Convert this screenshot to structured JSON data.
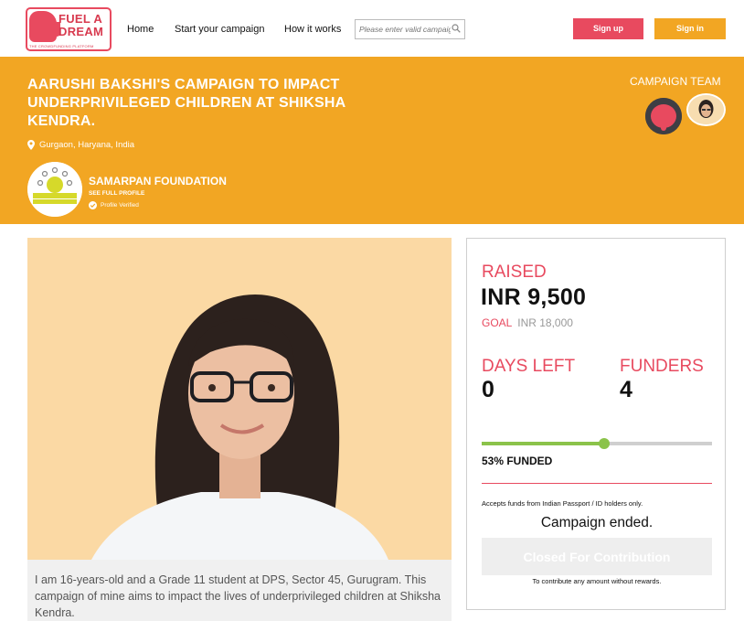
{
  "brand": {
    "logo_text": "FUEL A DREAM",
    "tagline": "THE CROWDFUNDING PLATFORM",
    "primary_color": "#e84a5f",
    "accent_color": "#f2a623"
  },
  "nav": {
    "home": "Home",
    "start_campaign": "Start your campaign",
    "how_it_works": "How it works",
    "search_placeholder": "Please enter valid campaign"
  },
  "auth": {
    "signup": "Sign up",
    "signin": "Sign in"
  },
  "campaign": {
    "title": "AARUSHI BAKSHI'S CAMPAIGN TO IMPACT UNDERPRIVILEGED CHILDREN AT SHIKSHA KENDRA.",
    "location": "Gurgaon, Haryana, India",
    "organization": {
      "name": "SAMARPAN FOUNDATION",
      "see_profile": "SEE FULL PROFILE",
      "verified": "Profile Verified"
    },
    "team_label": "CAMPAIGN TEAM",
    "description": "I am 16-years-old and a Grade 11 student at DPS, Sector 45, Gurugram. This campaign of mine aims to impact the lives of underprivileged children at Shiksha Kendra."
  },
  "stats": {
    "raised_label": "RAISED",
    "raised_value": "INR 9,500",
    "goal_label": "GOAL",
    "goal_value": "INR 18,000",
    "days_left_label": "DAYS LEFT",
    "days_left_value": "0",
    "funders_label": "FUNDERS",
    "funders_value": "4",
    "funded_percent": 53,
    "funded_text": "53% FUNDED",
    "accepts_note": "Accepts funds from Indian Passport / ID holders only.",
    "status": "Campaign ended.",
    "closed_button": "Closed For Contribution",
    "contribute_note": "To contribute any amount without rewards."
  }
}
